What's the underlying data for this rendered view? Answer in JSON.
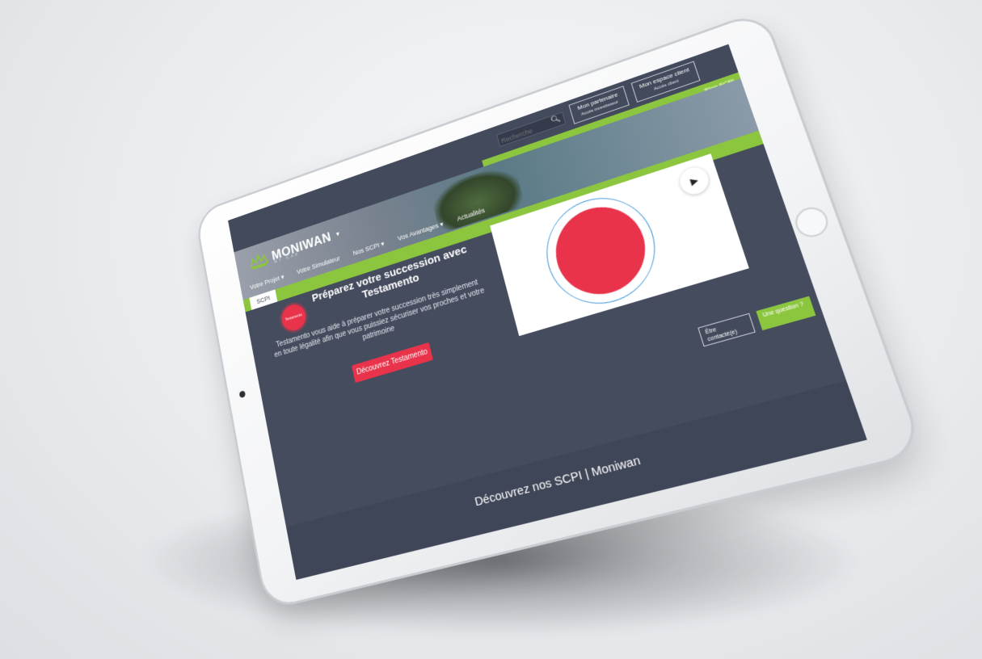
{
  "header": {
    "search_placeholder": "Recherche",
    "btn_partner": {
      "label": "Mon partenaire",
      "sub": "Accès investisseur"
    },
    "btn_client": {
      "label": "Mon espace client",
      "sub": "Accès client"
    },
    "blog": "Blog SCPI"
  },
  "logo": {
    "name": "MONIWAN",
    "sub": "BY CAP",
    "caret": "▾"
  },
  "nav": {
    "items": [
      "Votre Projet ▾",
      "Votre Simulateur",
      "Nos SCPI ▾",
      "Vos Avantages ▾",
      "Actualités"
    ],
    "active_tab": "SCPI"
  },
  "promo": {
    "seal": "Testamento",
    "title": "Préparez votre succession avec Testamento",
    "text": "Testamento vous aide à préparer votre succession très simplement en toute légalité afin que vous puissiez sécuriser vos proches et votre patrimoine",
    "cta": "Découvrez Testamento"
  },
  "video": {
    "play": "▶"
  },
  "floating": {
    "contact": "Être contacté(e)",
    "question": "Une question ?"
  },
  "section": {
    "title": "Découvrez nos SCPI | Moniwan"
  },
  "colors": {
    "accent": "#8cc63f",
    "cta": "#e8334a",
    "background": "#434a5c"
  }
}
